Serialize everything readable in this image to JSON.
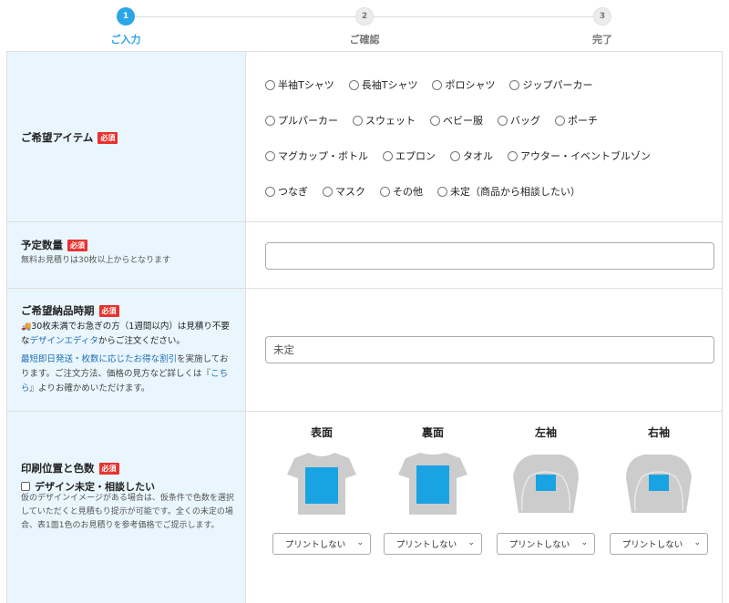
{
  "stepper": {
    "steps": [
      {
        "num": "1",
        "label": "ご入力"
      },
      {
        "num": "2",
        "label": "ご確認"
      },
      {
        "num": "3",
        "label": "完了"
      }
    ]
  },
  "required_badge": "必須",
  "item": {
    "title": "ご希望アイテム",
    "options": [
      [
        "半袖Tシャツ",
        "長袖Tシャツ",
        "ポロシャツ",
        "ジップパーカー"
      ],
      [
        "プルパーカー",
        "スウェット",
        "ベビー服",
        "バッグ",
        "ポーチ"
      ],
      [
        "マグカップ・ボトル",
        "エプロン",
        "タオル",
        "アウター・イベントブルゾン"
      ],
      [
        "つなぎ",
        "マスク",
        "その他",
        "未定（商品から相談したい）"
      ]
    ]
  },
  "quantity": {
    "title": "予定数量",
    "note": "無料お見積りは30枚以上からとなります",
    "value": ""
  },
  "delivery": {
    "title": "ご希望納品時期",
    "note_prefix": "30枚未満でお急ぎの方（1週間以内）は見積り不要な",
    "note_link": "デザインエディタ",
    "note_suffix": "からご注文ください。",
    "info_link": "最短即日発送・枚数に応じたお得な割引",
    "info_text": "を実施しております。ご注文方法、価格の見方など詳しくは『",
    "info_link2": "こちら",
    "info_end": "』よりお確かめいただけます。",
    "value": "未定"
  },
  "print": {
    "title": "印刷位置と色数",
    "checkbox_label": "デザイン未定・相談したい",
    "note": "仮のデザインイメージがある場合は、仮条件で色数を選択していただくと見積もり提示が可能です。全くの未定の場合、表1面1色のお見積りを参考価格でご提示します。",
    "positions": [
      {
        "label": "表面",
        "select": "プリントしない"
      },
      {
        "label": "裏面",
        "select": "プリントしない"
      },
      {
        "label": "左袖",
        "select": "プリントしない"
      },
      {
        "label": "右袖",
        "select": "プリントしない"
      }
    ]
  },
  "colors": {
    "accent": "#2aa6e6",
    "required": "#e8322e",
    "label_bg": "#e9f6fd",
    "garment": "#cccccc",
    "print_area": "#1aa3e3"
  }
}
